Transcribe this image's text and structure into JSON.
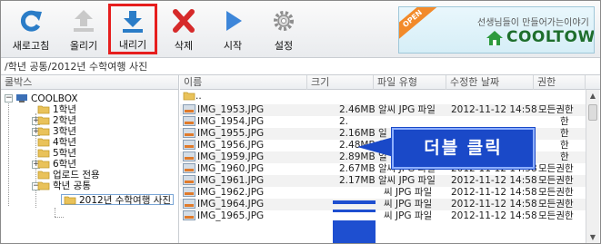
{
  "toolbar": {
    "buttons": [
      {
        "label": "새로고침",
        "icon": "refresh-icon"
      },
      {
        "label": "올리기",
        "icon": "upload-icon"
      },
      {
        "label": "내리기",
        "icon": "download-icon"
      },
      {
        "label": "삭제",
        "icon": "delete-icon"
      },
      {
        "label": "시작",
        "icon": "play-icon"
      },
      {
        "label": "설정",
        "icon": "gear-icon"
      }
    ],
    "banner": {
      "badge": "OPEN",
      "tagline": "선생님들이 만들어가는이야기",
      "brand": "COOLTOWN"
    },
    "colors": {
      "refresh": "#2a7cc7",
      "download": "#2a7cc7",
      "delete": "#d62a2a",
      "play": "#3d86d9",
      "highlight": "#e61e1e"
    }
  },
  "path": "/학년 공통/2012년 수학여행 사진",
  "left_pane": {
    "header": "쿨박스",
    "tree": [
      {
        "label": "COOLBOX",
        "level": 0
      },
      {
        "label": "1학년",
        "level": 1
      },
      {
        "label": "2학년",
        "level": 1
      },
      {
        "label": "3학년",
        "level": 1
      },
      {
        "label": "4학년",
        "level": 1
      },
      {
        "label": "5학년",
        "level": 1
      },
      {
        "label": "6학년",
        "level": 1
      },
      {
        "label": "업로드 전용",
        "level": 1
      },
      {
        "label": "학년 공통",
        "level": 1
      },
      {
        "label": "2012년 수학여행 사진",
        "level": 2
      }
    ]
  },
  "file_list": {
    "columns": [
      "이름",
      "크기",
      "파일 유형",
      "수정한 날짜",
      "권한"
    ],
    "parent_row": "..",
    "rows": [
      {
        "name": "IMG_1953.JPG",
        "size": "2.46MB",
        "type": "알씨 JPG 파일",
        "date": "",
        "perm": "모든권한"
      },
      {
        "name": "IMG_1954.JPG",
        "size": "2.",
        "type": "",
        "date": "",
        "perm": "한"
      },
      {
        "name": "IMG_1955.JPG",
        "size": "2.16MB",
        "type": "일",
        "date": "",
        "perm": "한"
      },
      {
        "name": "IMG_1956.JPG",
        "size": "2.48MB",
        "type": "일",
        "date": "",
        "perm": "한"
      },
      {
        "name": "IMG_1959.JPG",
        "size": "2.89MB",
        "type": "일",
        "date": "",
        "perm": "한"
      },
      {
        "name": "IMG_1960.JPG",
        "size": "2.67MB",
        "type": "알씨 JPG 파일",
        "date": "2012-11-12 14:58",
        "perm": "모든권한"
      },
      {
        "name": "IMG_1961.JPG",
        "size": "2.17MB",
        "type": "알씨 JPG 파일",
        "date": "2012-11-12 14:58",
        "perm": "모든권한"
      },
      {
        "name": "IMG_1962.JPG",
        "size": "",
        "type": "씨 JPG 파일",
        "date": "2012-11-12 14:58",
        "perm": "모든권한"
      },
      {
        "name": "IMG_1964.JPG",
        "size": "",
        "type": "씨 JPG 파일",
        "date": "2012-11-12 14:58",
        "perm": "모든권한"
      },
      {
        "name": "IMG_1965.JPG",
        "size": "",
        "type": "씨 JPG 파일",
        "date": "2012-11-12 14:58",
        "perm": "모든권한"
      }
    ],
    "first_row_date": "2012-11-12 14:58"
  },
  "callout": "더블 클릭"
}
